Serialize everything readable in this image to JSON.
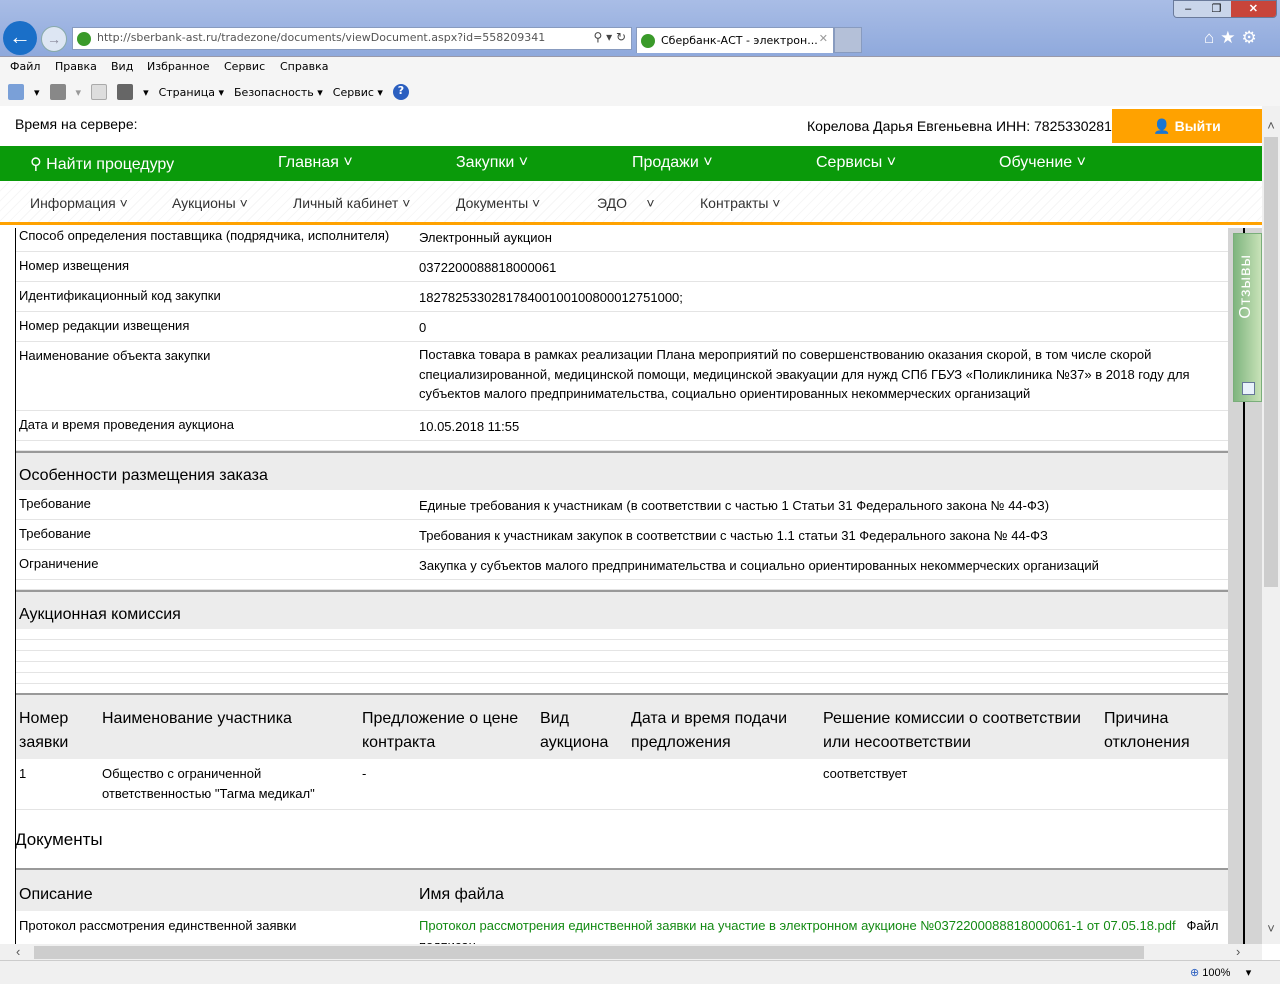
{
  "browser": {
    "url": "http://sberbank-ast.ru/tradezone/documents/viewDocument.aspx?id=558209341",
    "tab_title": "Сбербанк-АСТ - электрон...",
    "menu": [
      "Файл",
      "Правка",
      "Вид",
      "Избранное",
      "Сервис",
      "Справка"
    ],
    "commands": [
      "Страница",
      "Безопасность",
      "Сервис"
    ],
    "zoom": "100%"
  },
  "header": {
    "server_time_label": "Время на сервере:",
    "user": "Корелова Дарья Евгеньевна ИНН: 7825330281",
    "logout": "Выйти"
  },
  "main_nav": [
    "Найти процедуру",
    "Главная",
    "Закупки",
    "Продажи",
    "Сервисы",
    "Обучение"
  ],
  "sub_nav": [
    "Информация",
    "Аукционы",
    "Личный кабинет",
    "Документы",
    "ЭДО",
    "Контракты"
  ],
  "reviews_tab": "Отзывы",
  "details": [
    {
      "label": "Способ определения поставщика (подрядчика, исполнителя)",
      "value": "Электронный аукцион"
    },
    {
      "label": "Номер извещения",
      "value": "0372200088818000061"
    },
    {
      "label": "Идентификационный код закупки",
      "value": "182782533028178400100100800012751000;"
    },
    {
      "label": "Номер редакции извещения",
      "value": "0"
    },
    {
      "label": "Наименование объекта закупки",
      "value": "Поставка товара в рамках реализации Плана мероприятий по совершенствованию оказания скорой, в том числе скорой специализированной, медицинской помощи, медицинской эвакуации для нужд СПб ГБУЗ «Поликлиника №37» в 2018 году для субъектов малого предпринимательства, социально ориентированных некоммерческих организаций"
    },
    {
      "label": "Дата и время проведения аукциона",
      "value": "10.05.2018 11:55"
    }
  ],
  "features": {
    "title": "Особенности размещения заказа",
    "rows": [
      {
        "label": "Требование",
        "value": "Единые требования к участникам (в соответствии с частью 1 Статьи 31 Федерального закона № 44-ФЗ)"
      },
      {
        "label": "Требование",
        "value": "Требования к участникам закупок в соответствии с частью 1.1 статьи 31 Федерального закона № 44-ФЗ"
      },
      {
        "label": "Ограничение",
        "value": "Закупка у субъектов малого предпринимательства и социально ориентированных некоммерческих организаций"
      }
    ]
  },
  "commission": {
    "title": "Аукционная комиссия"
  },
  "bids": {
    "columns": [
      "Номер заявки",
      "Наименование участника",
      "Предложение о цене контракта",
      "Вид аукциона",
      "Дата и время подачи предложения",
      "Решение комиссии о соответствии или несоответствии",
      "Причина отклонения"
    ],
    "rows": [
      [
        "1",
        "Общество с ограниченной ответственностью \"Тагма медикал\"",
        "-",
        "",
        "",
        "соответствует",
        ""
      ]
    ]
  },
  "documents": {
    "title": "Документы",
    "columns": [
      "Описание",
      "Имя файла"
    ],
    "rows": [
      {
        "description": "Протокол рассмотрения единственной заявки",
        "file": "Протокол рассмотрения единственной заявки на участие в электронном аукционе №0372200088818000061-1 от 07.05.18.pdf",
        "status": "Файл подписан"
      }
    ]
  }
}
